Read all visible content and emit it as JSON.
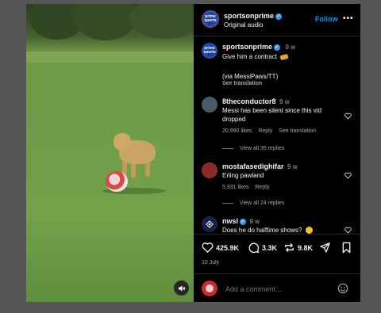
{
  "post": {
    "username": "sportsonprime",
    "audio": "Original audio",
    "follow_label": "Follow",
    "more_label": "•••",
    "avatar_text": "prime sports"
  },
  "caption": {
    "username": "sportsonprime",
    "time": "9 w",
    "text": "Give him a contract",
    "credit": "(via MessiPaws/TT)",
    "see_translation": "See translation"
  },
  "comments": [
    {
      "username": "8theconductor8",
      "time": "9 w",
      "text_line1": "Messi has been silent since this vid",
      "text_line2": "dropped",
      "likes": "20,990 likes",
      "reply": "Reply",
      "translation": "See translation",
      "view_replies": "View all 35 replies"
    },
    {
      "username": "mostafasedighifar",
      "time": "9 w",
      "text_line1": "Erling pawland",
      "likes": "5,931 likes",
      "reply": "Reply",
      "view_replies": "View all 24 replies"
    },
    {
      "username": "nwsl",
      "time": "9 w",
      "text_line1": "Does he do halftime shows?"
    }
  ],
  "stats": {
    "likes": "425.9K",
    "comments": "3.3K",
    "reposts": "9.8K",
    "date": "10 July"
  },
  "comment_input": {
    "placeholder": "Add a comment..."
  },
  "colors": {
    "accent": "#0095f6",
    "background": "#000000",
    "verified": "#3897f0"
  }
}
